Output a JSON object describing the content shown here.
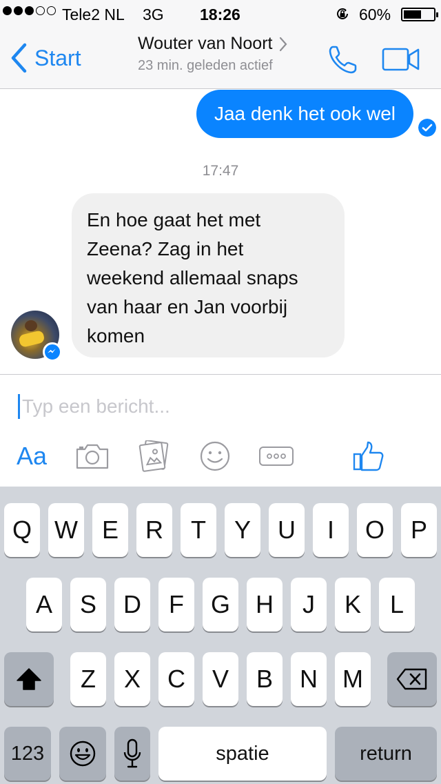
{
  "status_bar": {
    "carrier": "Tele2 NL",
    "network": "3G",
    "time": "18:26",
    "battery": "60%",
    "battery_level": 0.6,
    "signal_bars_filled": 3,
    "signal_bars_total": 5,
    "icons": [
      "signal-dots",
      "orientation-lock-icon",
      "battery-icon"
    ]
  },
  "header": {
    "back_label": "Start",
    "contact_name": "Wouter van Noort",
    "presence": "23 min. geleden actief",
    "icons": [
      "chevron-left-icon",
      "chevron-right-icon",
      "phone-icon",
      "video-camera-icon"
    ],
    "accent_color": "#1e87f0"
  },
  "conversation": {
    "outgoing": {
      "text": "Jaa denk het ook wel",
      "status": "seen-check-icon",
      "color": "#0a84ff"
    },
    "timestamp": "17:47",
    "incoming": {
      "lines": [
        "En hoe gaat het met",
        "Zeena? Zag in het",
        "weekend allemaal snaps",
        "van haar en Jan voorbij",
        "komen"
      ],
      "avatar": "avatar",
      "badge": "messenger-icon",
      "color": "#f0f0f0"
    }
  },
  "composer": {
    "placeholder": "Typ een bericht...",
    "value": "",
    "text_button": "Aa",
    "tools": [
      "camera-icon",
      "photo-gallery-icon",
      "emoji-icon",
      "more-icon",
      "like-icon"
    ]
  },
  "keyboard": {
    "row1": [
      "Q",
      "W",
      "E",
      "R",
      "T",
      "Y",
      "U",
      "I",
      "O",
      "P"
    ],
    "row2": [
      "A",
      "S",
      "D",
      "F",
      "G",
      "H",
      "J",
      "K",
      "L"
    ],
    "row3": [
      "Z",
      "X",
      "C",
      "V",
      "B",
      "N",
      "M"
    ],
    "numbers_label": "123",
    "space_label": "spatie",
    "return_label": "return",
    "icons": [
      "shift-icon",
      "backspace-icon",
      "emoji-keyboard-icon",
      "microphone-icon"
    ]
  }
}
